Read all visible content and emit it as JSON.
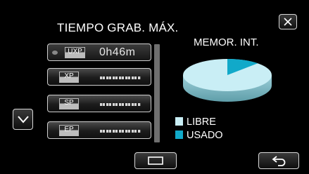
{
  "header": {
    "title": "TIEMPO GRAB. MÁX."
  },
  "icons": {
    "close": "close-x-icon",
    "scroll_down": "chevron-down-icon",
    "center": "rectangle-frame-icon",
    "back": "return-arrow-icon",
    "selected_indicator": "led-dot-icon"
  },
  "modes": [
    {
      "badge": "UXP",
      "value": "0h46m",
      "selected": true
    },
    {
      "badge": "XP",
      "value": "",
      "selected": false
    },
    {
      "badge": "SP",
      "value": "",
      "selected": false
    },
    {
      "badge": "EP",
      "value": "",
      "selected": false
    }
  ],
  "memory": {
    "title": "MEMOR. INT.",
    "free_label": "LIBRE",
    "used_label": "USADO",
    "free_color": "#c9eef5",
    "used_color": "#11a9c9",
    "used_fraction": 0.12
  }
}
